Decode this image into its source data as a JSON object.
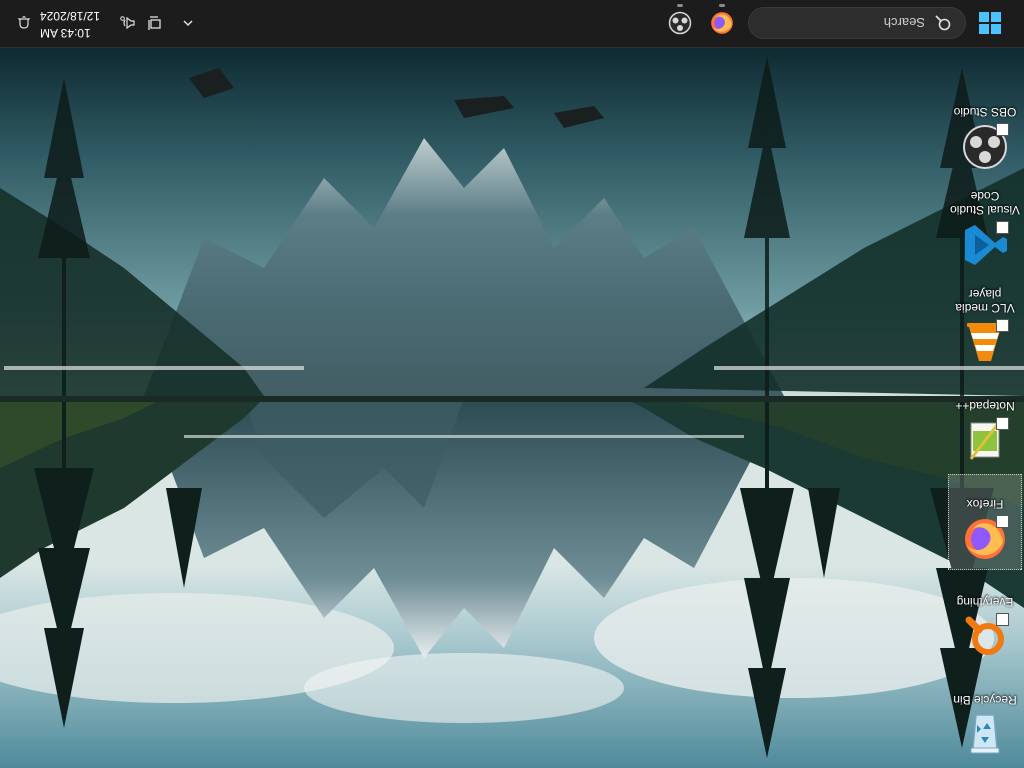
{
  "desktop": {
    "icons": [
      {
        "label": "Recycle Bin"
      },
      {
        "label": "Everything"
      },
      {
        "label": "Firefox"
      },
      {
        "label": "Notepad++"
      },
      {
        "label": "VLC media player"
      },
      {
        "label": "Visual Studio Code"
      },
      {
        "label": "OBS Studio"
      }
    ],
    "selected_icon": "Firefox"
  },
  "taskbar": {
    "start_icon": "windows-logo",
    "search_placeholder": "Search",
    "pinned_apps": [
      {
        "name": "Firefox",
        "icon": "firefox-icon",
        "running": true
      },
      {
        "name": "OBS Studio",
        "icon": "obs-icon",
        "running": true
      }
    ],
    "tray": {
      "icons": [
        "chevron-up-icon",
        "network-icon",
        "volume-icon"
      ],
      "time": "10:43 AM",
      "date": "12/18/2024"
    }
  },
  "colors": {
    "taskbar_bg": "#1c1c1c",
    "windows_blue": "#0078d4",
    "vscode_blue": "#1a8ad4",
    "vlc_orange": "#f28a0c",
    "everything_orange": "#f07a10"
  }
}
